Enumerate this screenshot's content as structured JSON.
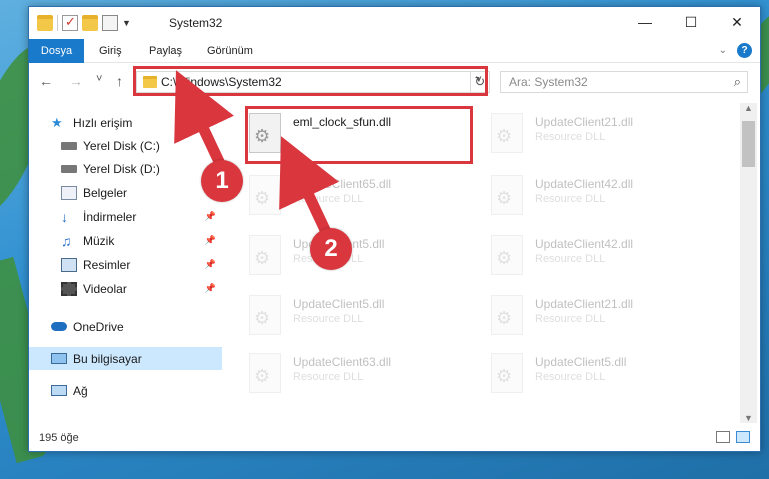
{
  "window": {
    "title": "System32",
    "controls": {
      "minimize": "—",
      "maximize": "☐",
      "close": "✕"
    }
  },
  "ribbon": {
    "tabs": [
      "Dosya",
      "Giriş",
      "Paylaş",
      "Görünüm"
    ],
    "expand_icon": "chevron-down-icon",
    "help_label": "?"
  },
  "navigation": {
    "back": "←",
    "forward": "→",
    "recent": "˅",
    "up": "↑",
    "address": "C:\\Windows\\System32",
    "address_drop": "˅",
    "refresh": "↻",
    "search_placeholder": "Ara: System32",
    "search_glyph": "⌕"
  },
  "sidebar": {
    "items": [
      {
        "label": "Hızlı erişim",
        "icon": "star-icon",
        "indent": 0,
        "pinned": false
      },
      {
        "label": "Yerel Disk (C:)",
        "icon": "drive-icon",
        "indent": 1,
        "pinned": false
      },
      {
        "label": "Yerel Disk (D:)",
        "icon": "drive-icon",
        "indent": 1,
        "pinned": false
      },
      {
        "label": "Belgeler",
        "icon": "documents-icon",
        "indent": 1,
        "pinned": false
      },
      {
        "label": "İndirmeler",
        "icon": "download-icon",
        "indent": 1,
        "pinned": true
      },
      {
        "label": "Müzik",
        "icon": "music-icon",
        "indent": 1,
        "pinned": true
      },
      {
        "label": "Resimler",
        "icon": "pictures-icon",
        "indent": 1,
        "pinned": true
      },
      {
        "label": "Videolar",
        "icon": "videos-icon",
        "indent": 1,
        "pinned": true
      },
      {
        "label": "OneDrive",
        "icon": "cloud-icon",
        "indent": 0,
        "pinned": false
      },
      {
        "label": "Bu bilgisayar",
        "icon": "computer-icon",
        "indent": 0,
        "pinned": false,
        "selected": true
      },
      {
        "label": "Ağ",
        "icon": "network-icon",
        "indent": 0,
        "pinned": false
      }
    ]
  },
  "files": [
    {
      "name": "eml_clock_sfun.dll",
      "type": "",
      "highlight": true
    },
    {
      "name": "UpdateClient21.dll",
      "type": "Resource DLL"
    },
    {
      "name": "UpdateClient65.dll",
      "type": "Resource DLL"
    },
    {
      "name": "UpdateClient42.dll",
      "type": "Resource DLL"
    },
    {
      "name": "UpdateClient5.dll",
      "type": "Resource DLL"
    },
    {
      "name": "UpdateClient42.dll",
      "type": "Resource DLL"
    },
    {
      "name": "UpdateClient5.dll",
      "type": "Resource DLL"
    },
    {
      "name": "UpdateClient21.dll",
      "type": "Resource DLL"
    },
    {
      "name": "UpdateClient63.dll",
      "type": "Resource DLL"
    },
    {
      "name": "UpdateClient5.dll",
      "type": "Resource DLL"
    }
  ],
  "status": {
    "count": "195 öğe"
  },
  "annotations": {
    "step1": "1",
    "step2": "2",
    "color": "#d9363e"
  },
  "colors": {
    "accent": "#1979ca",
    "selection": "#cce8ff",
    "highlight": "#d9363e"
  }
}
